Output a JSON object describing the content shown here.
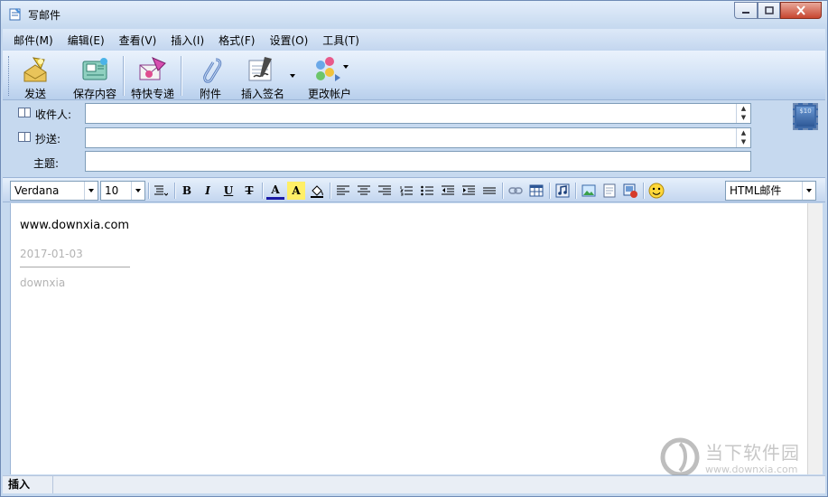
{
  "window": {
    "title": "写邮件",
    "controls": {
      "minimize": "—",
      "maximize": "□",
      "close": "✕"
    }
  },
  "menu": [
    "邮件(M)",
    "编辑(E)",
    "查看(V)",
    "插入(I)",
    "格式(F)",
    "设置(O)",
    "工具(T)"
  ],
  "toolbar": {
    "send": "发送",
    "save": "保存内容",
    "express": "特快专递",
    "attach": "附件",
    "signature": "插入签名",
    "account": "更改帐户"
  },
  "address": {
    "to_label": "收件人:",
    "cc_label": "抄送:",
    "subject_label": "主题:",
    "to_value": "",
    "cc_value": "",
    "subject_value": "",
    "stamp_text": "$10"
  },
  "format": {
    "font": "Verdana",
    "size": "10",
    "bold": "B",
    "italic": "I",
    "underline": "U",
    "strike": "T",
    "font_color": "A",
    "highlight": "A",
    "mode": "HTML邮件"
  },
  "body": {
    "line1": "www.downxia.com",
    "date": "2017-01-03",
    "signature": "downxia"
  },
  "watermark": {
    "name": "当下软件园",
    "url": "www.downxia.com"
  },
  "status": {
    "mode": "插入"
  }
}
